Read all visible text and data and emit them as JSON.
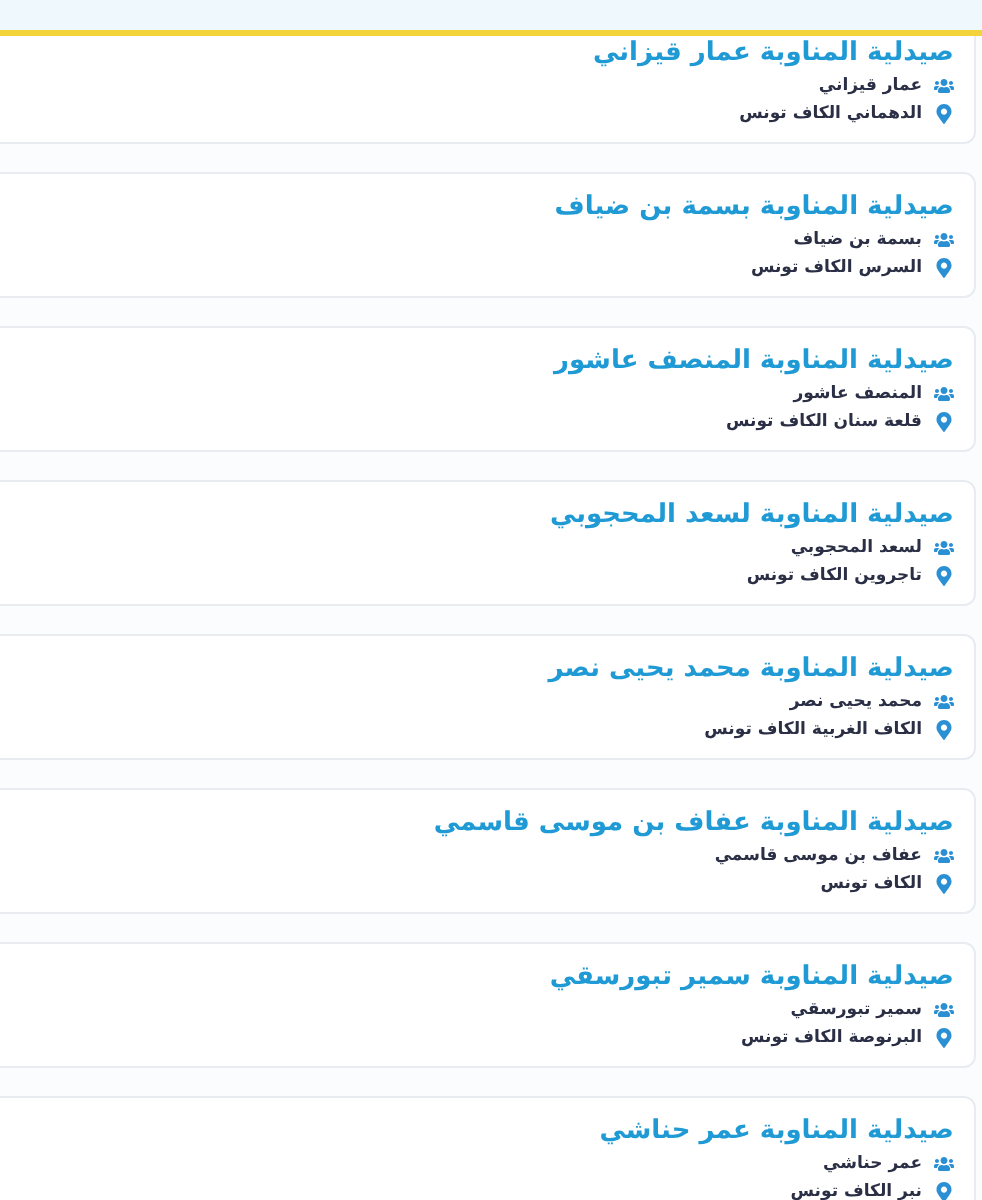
{
  "pharmacies": [
    {
      "title": "صيدلية المناوبة عمار قيزاني",
      "owner": "عمار قيزاني",
      "address": "الدهماني الكاف تونس"
    },
    {
      "title": "صيدلية المناوبة بسمة بن ضياف",
      "owner": "بسمة بن ضياف",
      "address": "السرس الكاف تونس"
    },
    {
      "title": "صيدلية المناوبة المنصف عاشور",
      "owner": "المنصف عاشور",
      "address": "قلعة سنان الكاف تونس"
    },
    {
      "title": "صيدلية المناوبة لسعد المحجوبي",
      "owner": "لسعد المحجوبي",
      "address": "تاجروين الكاف تونس"
    },
    {
      "title": "صيدلية المناوبة محمد يحيى نصر",
      "owner": "محمد يحيى نصر",
      "address": "الكاف الغربية الكاف تونس"
    },
    {
      "title": "صيدلية المناوبة عفاف بن موسى قاسمي",
      "owner": "عفاف بن موسى قاسمي",
      "address": "الكاف تونس"
    },
    {
      "title": "صيدلية المناوبة سمير تبورسقي",
      "owner": "سمير تبورسقي",
      "address": "البرنوصة الكاف تونس"
    },
    {
      "title": "صيدلية المناوبة عمر حناشي",
      "owner": "عمر حناشي",
      "address": "نبر الكاف تونس"
    }
  ]
}
